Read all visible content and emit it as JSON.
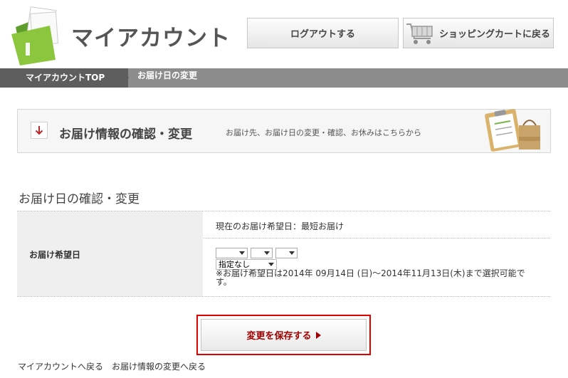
{
  "header": {
    "title": "マイアカウント",
    "logout_label": "ログアウトする",
    "cart_label": "ショッピングカートに戻る"
  },
  "breadcrumb": {
    "top_label": "マイアカウントTOP",
    "current_label": "お届け日の変更"
  },
  "banner": {
    "title": "お届け情報の確認・変更",
    "description": "お届け先、お届け日の変更・確認、お休みはこちらから"
  },
  "section": {
    "title": "お届け日の確認・変更"
  },
  "form": {
    "label": "お届け希望日",
    "current_date_text": "現在のお届け希望日：最短お届け",
    "year_value": "",
    "month_value": "",
    "day_value": "",
    "time_value": "指定なし",
    "note": "※お届け希望日は2014年 09月14日 (日)～2014年11月13日(木)まで選択可能です。"
  },
  "save_label": "変更を保存する",
  "footer": {
    "back_myaccount": "マイアカウントへ戻る",
    "back_delivery": "お届け情報の変更へ戻る"
  },
  "colors": {
    "accent_red": "#e00000",
    "save_text": "#a00000",
    "logo_green": "#8cc63f",
    "breadcrumb_dark": "#5e5e5e",
    "breadcrumb_light": "#8c8c8c"
  }
}
